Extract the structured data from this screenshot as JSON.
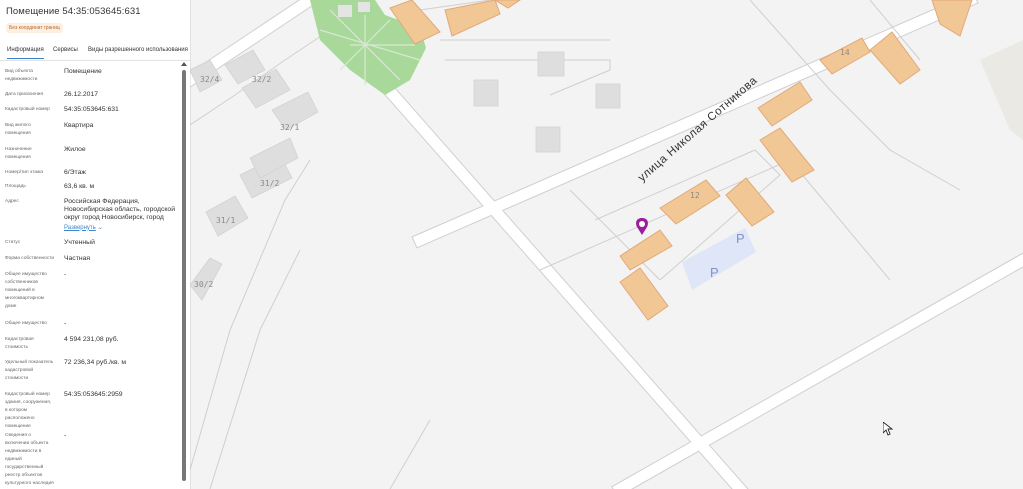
{
  "panel": {
    "title": "Помещение 54:35:053645:631",
    "badge": "Без координат границ",
    "tabs": [
      {
        "label": "Информация",
        "active": true
      },
      {
        "label": "Сервисы",
        "active": false
      },
      {
        "label": "Виды разрешенного использования",
        "active": false
      }
    ],
    "rows": [
      {
        "label": "Вид объекта недвижимости",
        "value": "Помещение"
      },
      {
        "label": "Дата присвоения",
        "value": "26.12.2017"
      },
      {
        "label": "Кадастровый номер",
        "value": "54:35:053645:631"
      },
      {
        "label": "Вид жилого помещения",
        "value": "Квартира"
      },
      {
        "label": "Назначение помещения",
        "value": "Жилое"
      },
      {
        "label": "Номер/тип этажа",
        "value": "6/Этаж"
      },
      {
        "label": "Площадь",
        "value": "63,6 кв. м"
      },
      {
        "label": "Адрес",
        "value": "Российская Федерация, Новосибирская область, городской округ город Новосибирск, город",
        "expand": "Развернуть"
      },
      {
        "label": "Статус",
        "value": "Учтенный"
      },
      {
        "label": "Форма собственности",
        "value": "Частная"
      },
      {
        "label": "Общее имущество собственников помещений в многоквартирном доме",
        "value": "-"
      },
      {
        "label": "Общее имущество",
        "value": "-"
      },
      {
        "label": "Кадастровая стоимость",
        "value": "4 594 231,08 руб."
      },
      {
        "label": "Удельный показатель кадастровой стоимости",
        "value": "72 236,34 руб./кв. м"
      },
      {
        "label": "Кадастровый номер здания, сооружения, в котором расположено помещение",
        "value": "54:35:053645:2959"
      },
      {
        "label": "Сведения о включении объекта недвижимости в единый государственный реестр объектов культурного наследия",
        "value": "-"
      }
    ]
  },
  "map": {
    "street_name": "улица Николая Сотникова",
    "building_labels": [
      "32/4",
      "32/2",
      "32/1",
      "31/2",
      "31/1",
      "30/2",
      "14",
      "12"
    ],
    "parking_label": "P",
    "marker_icon": "location-pin-icon",
    "colors": {
      "background": "#f3f3f3",
      "building": "#f2c796",
      "building_outline": "#e1a978",
      "grey_building": "#dedede",
      "park": "#a8d99a",
      "parking": "#dfe6f7",
      "marker": "#9b1f9b",
      "road_edge": "#cfcfcf"
    }
  }
}
